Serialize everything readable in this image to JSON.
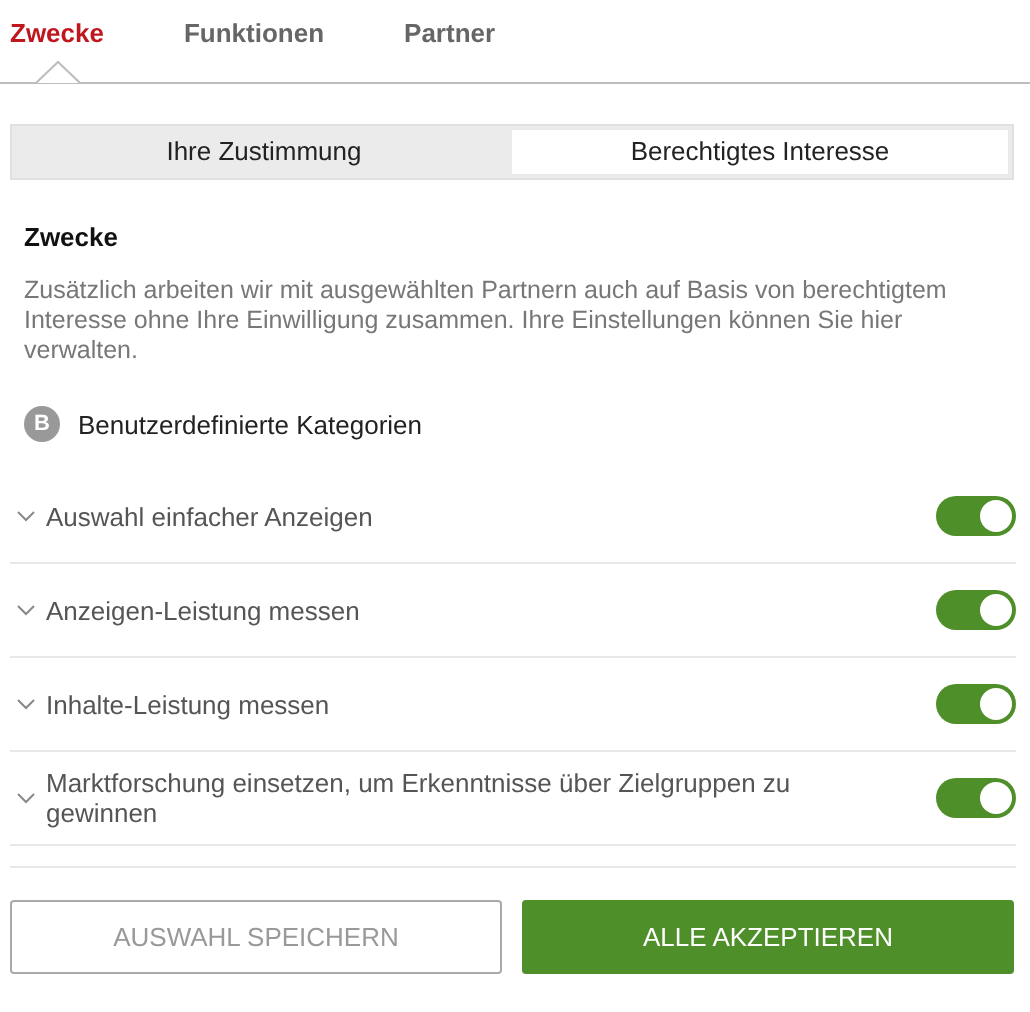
{
  "tabs": [
    {
      "label": "Zwecke",
      "selected": true
    },
    {
      "label": "Funktionen",
      "selected": false
    },
    {
      "label": "Partner",
      "selected": false
    }
  ],
  "segments": [
    {
      "label": "Ihre Zustimmung",
      "selected": false
    },
    {
      "label": "Berechtigtes Interesse",
      "selected": true
    }
  ],
  "section": {
    "title": "Zwecke",
    "description": "Zusätzlich arbeiten wir mit ausgewählten Partnern auch auf Basis von berechtigtem Interesse ohne Ihre Einwilligung zusammen. Ihre Einstellungen können Sie hier verwalten.",
    "category_badge": "B",
    "category": "Benutzerdefinierte Kategorien"
  },
  "purposes": [
    {
      "label": "Auswahl einfacher Anzeigen",
      "on": true
    },
    {
      "label": "Anzeigen-Leistung messen",
      "on": true
    },
    {
      "label": "Inhalte-Leistung messen",
      "on": true
    },
    {
      "label": "Marktforschung einsetzen, um Erkenntnisse über Zielgruppen zu gewinnen",
      "on": true
    }
  ],
  "buttons": [
    {
      "label": "AUSWAHL SPEICHERN",
      "kind": "secondary"
    },
    {
      "label": "ALLE AKZEPTIEREN",
      "kind": "primary"
    }
  ]
}
